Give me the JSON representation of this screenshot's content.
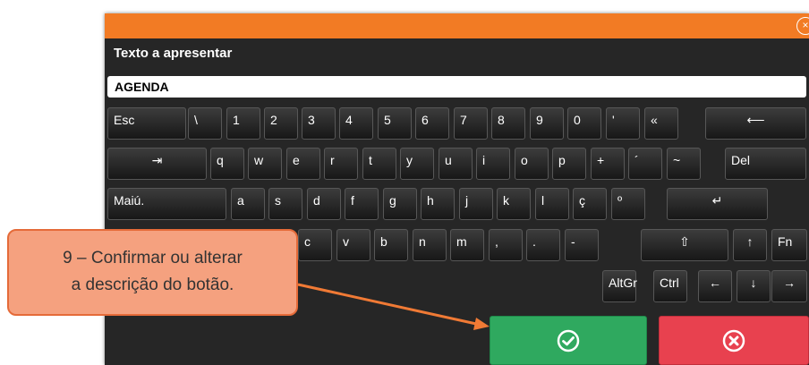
{
  "dialog": {
    "close_glyph": "×",
    "label": "Texto a apresentar",
    "field_value": "AGENDA",
    "accent": "#f27b24"
  },
  "keyboard": {
    "row1": [
      {
        "label": "Esc",
        "name": "key-esc"
      },
      {
        "label": "\\",
        "name": "key-backslash"
      },
      {
        "label": "1",
        "name": "key-1"
      },
      {
        "label": "2",
        "name": "key-2"
      },
      {
        "label": "3",
        "name": "key-3"
      },
      {
        "label": "4",
        "name": "key-4"
      },
      {
        "label": "5",
        "name": "key-5"
      },
      {
        "label": "6",
        "name": "key-6"
      },
      {
        "label": "7",
        "name": "key-7"
      },
      {
        "label": "8",
        "name": "key-8"
      },
      {
        "label": "9",
        "name": "key-9"
      },
      {
        "label": "0",
        "name": "key-0"
      },
      {
        "label": "'",
        "name": "key-apostrophe"
      },
      {
        "label": "«",
        "name": "key-guillemet"
      },
      {
        "label": "⟵",
        "name": "key-backspace"
      }
    ],
    "row2": [
      {
        "label": "⇥",
        "name": "key-tab"
      },
      {
        "label": "q",
        "name": "key-q"
      },
      {
        "label": "w",
        "name": "key-w"
      },
      {
        "label": "e",
        "name": "key-e"
      },
      {
        "label": "r",
        "name": "key-r"
      },
      {
        "label": "t",
        "name": "key-t"
      },
      {
        "label": "y",
        "name": "key-y"
      },
      {
        "label": "u",
        "name": "key-u"
      },
      {
        "label": "i",
        "name": "key-i"
      },
      {
        "label": "o",
        "name": "key-o"
      },
      {
        "label": "p",
        "name": "key-p"
      },
      {
        "label": "+",
        "name": "key-plus"
      },
      {
        "label": "´",
        "name": "key-acute"
      },
      {
        "label": "~",
        "name": "key-tilde"
      },
      {
        "label": "Del",
        "name": "key-del"
      }
    ],
    "row3": [
      {
        "label": "Maiú.",
        "name": "key-capslock"
      },
      {
        "label": "a",
        "name": "key-a"
      },
      {
        "label": "s",
        "name": "key-s"
      },
      {
        "label": "d",
        "name": "key-d"
      },
      {
        "label": "f",
        "name": "key-f"
      },
      {
        "label": "g",
        "name": "key-g"
      },
      {
        "label": "h",
        "name": "key-h"
      },
      {
        "label": "j",
        "name": "key-j"
      },
      {
        "label": "k",
        "name": "key-k"
      },
      {
        "label": "l",
        "name": "key-l"
      },
      {
        "label": "ç",
        "name": "key-c-cedilla"
      },
      {
        "label": "º",
        "name": "key-ordinal"
      },
      {
        "label": "↵",
        "name": "key-enter"
      }
    ],
    "row4": [
      {
        "label": "c",
        "name": "key-c"
      },
      {
        "label": "v",
        "name": "key-v"
      },
      {
        "label": "b",
        "name": "key-b"
      },
      {
        "label": "n",
        "name": "key-n"
      },
      {
        "label": "m",
        "name": "key-m"
      },
      {
        "label": ",",
        "name": "key-comma"
      },
      {
        "label": ".",
        "name": "key-period"
      },
      {
        "label": "-",
        "name": "key-minus"
      },
      {
        "label": "⇧",
        "name": "key-shift"
      },
      {
        "label": "↑",
        "name": "key-up"
      },
      {
        "label": "Fn",
        "name": "key-fn"
      }
    ],
    "row5": [
      {
        "label": "AltGr",
        "name": "key-altgr"
      },
      {
        "label": "Ctrl",
        "name": "key-ctrl"
      },
      {
        "label": "←",
        "name": "key-left"
      },
      {
        "label": "↓",
        "name": "key-down"
      },
      {
        "label": "→",
        "name": "key-right"
      }
    ]
  },
  "buttons": {
    "confirm_icon": "check-circle-icon",
    "cancel_icon": "x-circle-icon",
    "confirm_color": "#2fa95f",
    "cancel_color": "#e8414f"
  },
  "annotation": {
    "line1": "9 – Confirmar ou alterar",
    "line2": "a descrição do botão."
  }
}
